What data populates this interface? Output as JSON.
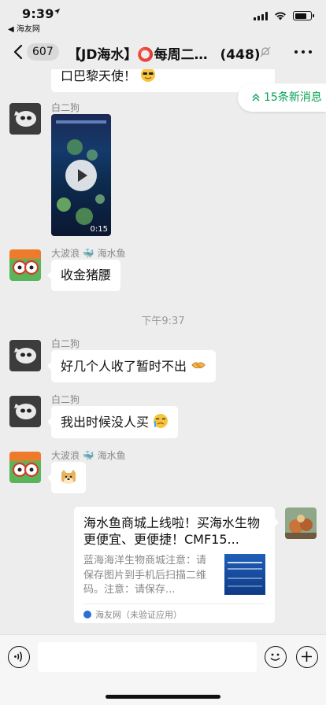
{
  "status_bar": {
    "time": "9:39",
    "back_app": "◀ 海友网",
    "battery_level": 0.75
  },
  "nav": {
    "unread_count": "607",
    "title": "【JD海水】⭕每周二…",
    "member_count": "(448)"
  },
  "new_messages": {
    "label": "15条新消息"
  },
  "messages": [
    {
      "kind": "text",
      "sender": "",
      "text": "口巴黎天使！"
    },
    {
      "kind": "video",
      "sender": "白二狗",
      "duration": "0:15"
    },
    {
      "kind": "text",
      "sender": "大波浪 🐳 海水鱼",
      "text": "收金猪腰"
    },
    {
      "kind": "timestamp",
      "text": "下午9:37"
    },
    {
      "kind": "text",
      "sender": "白二狗",
      "text": "好几个人收了暂时不出"
    },
    {
      "kind": "text",
      "sender": "白二狗",
      "text": "我出时候没人买"
    },
    {
      "kind": "sticker",
      "sender": "大波浪 🐳 海水鱼"
    },
    {
      "kind": "link",
      "title": "海水鱼商城上线啦！买海水生物更便宜、更便捷！CMF15...",
      "description": "蓝海海洋生物商城注意：请保存图片到手机后扫描二维码。注意：请保存...",
      "source": "海友网（未验证应用）"
    }
  ],
  "colors": {
    "wechat_green": "#07a055",
    "background": "#ededed"
  }
}
